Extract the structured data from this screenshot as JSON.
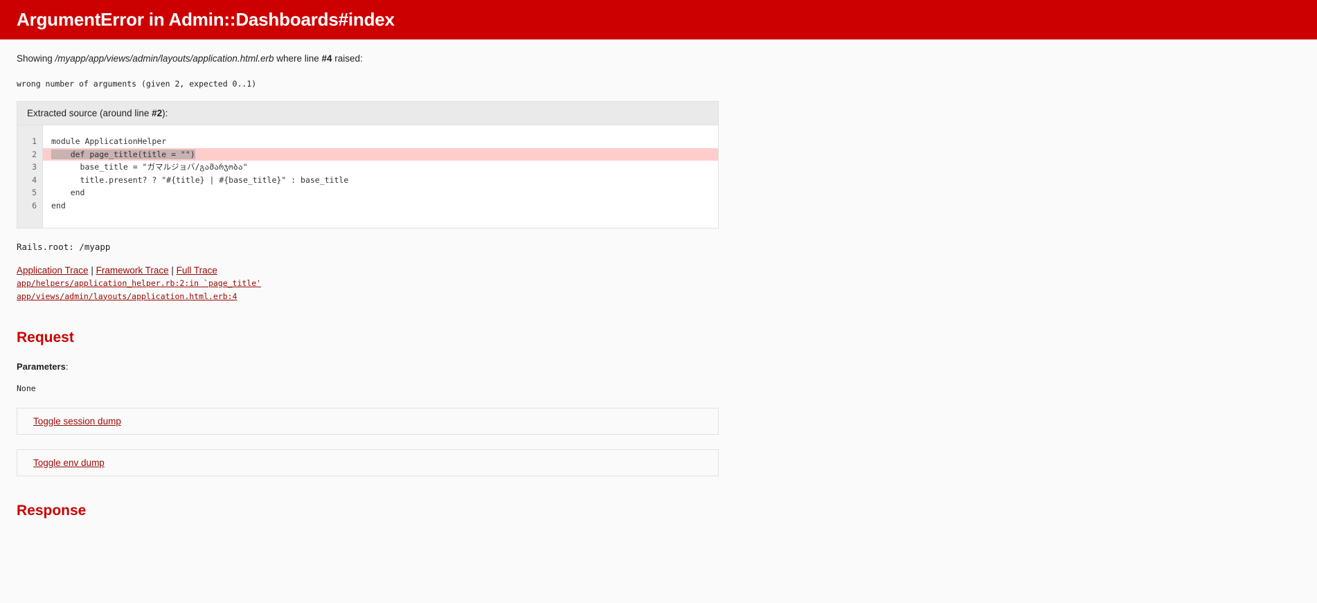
{
  "header": {
    "title": "ArgumentError in Admin::Dashboards#index",
    "background_color": "#CC0000",
    "text_color": "#FFFFFF"
  },
  "showing": {
    "prefix": "Showing ",
    "path": "/myapp/app/views/admin/layouts/application.html.erb",
    "middle": " where line ",
    "line_number": "#4",
    "suffix": " raised:"
  },
  "exception_message": "wrong number of arguments (given 2, expected 0..1)",
  "extracted_source": {
    "caption_prefix": "Extracted source (around line ",
    "caption_line": "#2",
    "caption_suffix": "):",
    "highlight_line_index": 1,
    "lines": [
      {
        "num": "1",
        "code": "module ApplicationHelper",
        "highlighted": false,
        "selected_text": ""
      },
      {
        "num": "2",
        "code": "    def page_title(title = \"\")",
        "highlighted": true,
        "selected_text": "    def page_title(title = \"\")"
      },
      {
        "num": "3",
        "code": "      base_title = \"ガマルジョバ/გამარჯობა\"",
        "highlighted": false,
        "selected_text": ""
      },
      {
        "num": "4",
        "code": "      title.present? ? \"#{title} | #{base_title}\" : base_title",
        "highlighted": false,
        "selected_text": ""
      },
      {
        "num": "5",
        "code": "    end",
        "highlighted": false,
        "selected_text": ""
      },
      {
        "num": "6",
        "code": "end",
        "highlighted": false,
        "selected_text": ""
      }
    ]
  },
  "rails_root": "Rails.root: /myapp",
  "traces": {
    "application_trace_label": "Application Trace",
    "framework_trace_label": "Framework Trace",
    "full_trace_label": "Full Trace",
    "separator": " | ",
    "frames": [
      "app/helpers/application_helper.rb:2:in `page_title'",
      "app/views/admin/layouts/application.html.erb:4"
    ]
  },
  "request_section": {
    "heading": "Request",
    "parameters_label": "Parameters",
    "parameters_label_suffix": ":",
    "parameters_value": "None",
    "toggle_session_dump": "Toggle session dump",
    "toggle_env_dump": "Toggle env dump"
  },
  "response_section": {
    "heading": "Response"
  },
  "colors": {
    "accent_red": "#CC0000",
    "link_red": "#980905",
    "highlight_pink": "#FFCCCC",
    "selection_gray": "#C8B2B2",
    "page_background": "#FAFAFA",
    "caption_background": "#EAEAEA"
  }
}
